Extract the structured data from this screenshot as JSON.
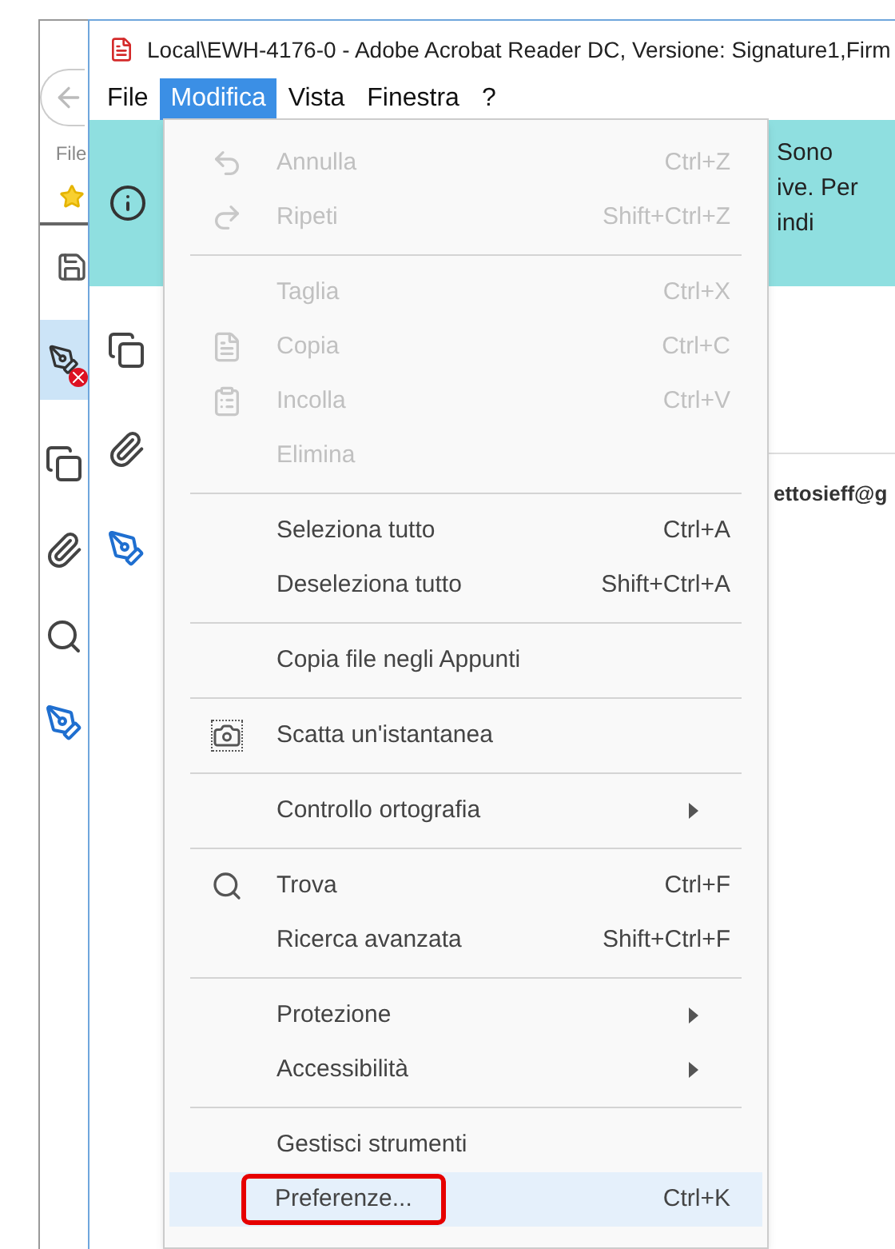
{
  "background_window": {
    "label": "File"
  },
  "window": {
    "title": "Local\\EWH-4176-0 - Adobe Acrobat Reader DC, Versione: Signature1,Firm"
  },
  "menu_bar": [
    {
      "label": "File",
      "selected": false
    },
    {
      "label": "Modifica",
      "selected": true
    },
    {
      "label": "Vista",
      "selected": false
    },
    {
      "label": "Finestra",
      "selected": false
    },
    {
      "label": "?",
      "selected": false
    }
  ],
  "info_banner": {
    "lines": [
      "Sono",
      "ive. Per",
      "indi"
    ]
  },
  "document": {
    "email": "ettosieff@g"
  },
  "menu": [
    {
      "kind": "undo",
      "label": "Annulla",
      "shortcut": "Ctrl+Z",
      "disabled": true,
      "selected": false
    },
    {
      "kind": "redo",
      "label": "Ripeti",
      "shortcut": "Shift+Ctrl+Z",
      "disabled": true,
      "selected": false
    },
    {
      "kind": "separator"
    },
    {
      "kind": "item",
      "label": "Taglia",
      "shortcut": "Ctrl+X",
      "disabled": true,
      "selected": false
    },
    {
      "kind": "copy",
      "label": "Copia",
      "shortcut": "Ctrl+C",
      "disabled": true,
      "selected": false
    },
    {
      "kind": "paste",
      "label": "Incolla",
      "shortcut": "Ctrl+V",
      "disabled": true,
      "selected": false
    },
    {
      "kind": "item",
      "label": "Elimina",
      "disabled": true,
      "selected": false
    },
    {
      "kind": "separator"
    },
    {
      "kind": "item",
      "label": "Seleziona tutto",
      "shortcut": "Ctrl+A",
      "disabled": false,
      "selected": false
    },
    {
      "kind": "item",
      "label": "Deseleziona tutto",
      "shortcut": "Shift+Ctrl+A",
      "disabled": false,
      "selected": false
    },
    {
      "kind": "separator"
    },
    {
      "kind": "item",
      "label": "Copia file negli Appunti",
      "disabled": false,
      "selected": false
    },
    {
      "kind": "separator"
    },
    {
      "kind": "camera",
      "label": "Scatta un'istantanea",
      "disabled": false,
      "selected": false
    },
    {
      "kind": "separator"
    },
    {
      "kind": "submenu",
      "label": "Controllo ortografia",
      "disabled": false,
      "selected": false
    },
    {
      "kind": "separator"
    },
    {
      "kind": "find",
      "label": "Trova",
      "shortcut": "Ctrl+F",
      "disabled": false,
      "selected": false
    },
    {
      "kind": "item",
      "label": "Ricerca avanzata",
      "shortcut": "Shift+Ctrl+F",
      "disabled": false,
      "selected": false
    },
    {
      "kind": "separator"
    },
    {
      "kind": "submenu",
      "label": "Protezione",
      "disabled": false,
      "selected": false
    },
    {
      "kind": "submenu",
      "label": "Accessibilità",
      "disabled": false,
      "selected": false
    },
    {
      "kind": "separator"
    },
    {
      "kind": "item",
      "label": "Gestisci strumenti",
      "disabled": false,
      "selected": false
    },
    {
      "kind": "item",
      "label": "Preferenze...",
      "shortcut": "Ctrl+K",
      "disabled": false,
      "selected": true,
      "outlined": true
    }
  ]
}
